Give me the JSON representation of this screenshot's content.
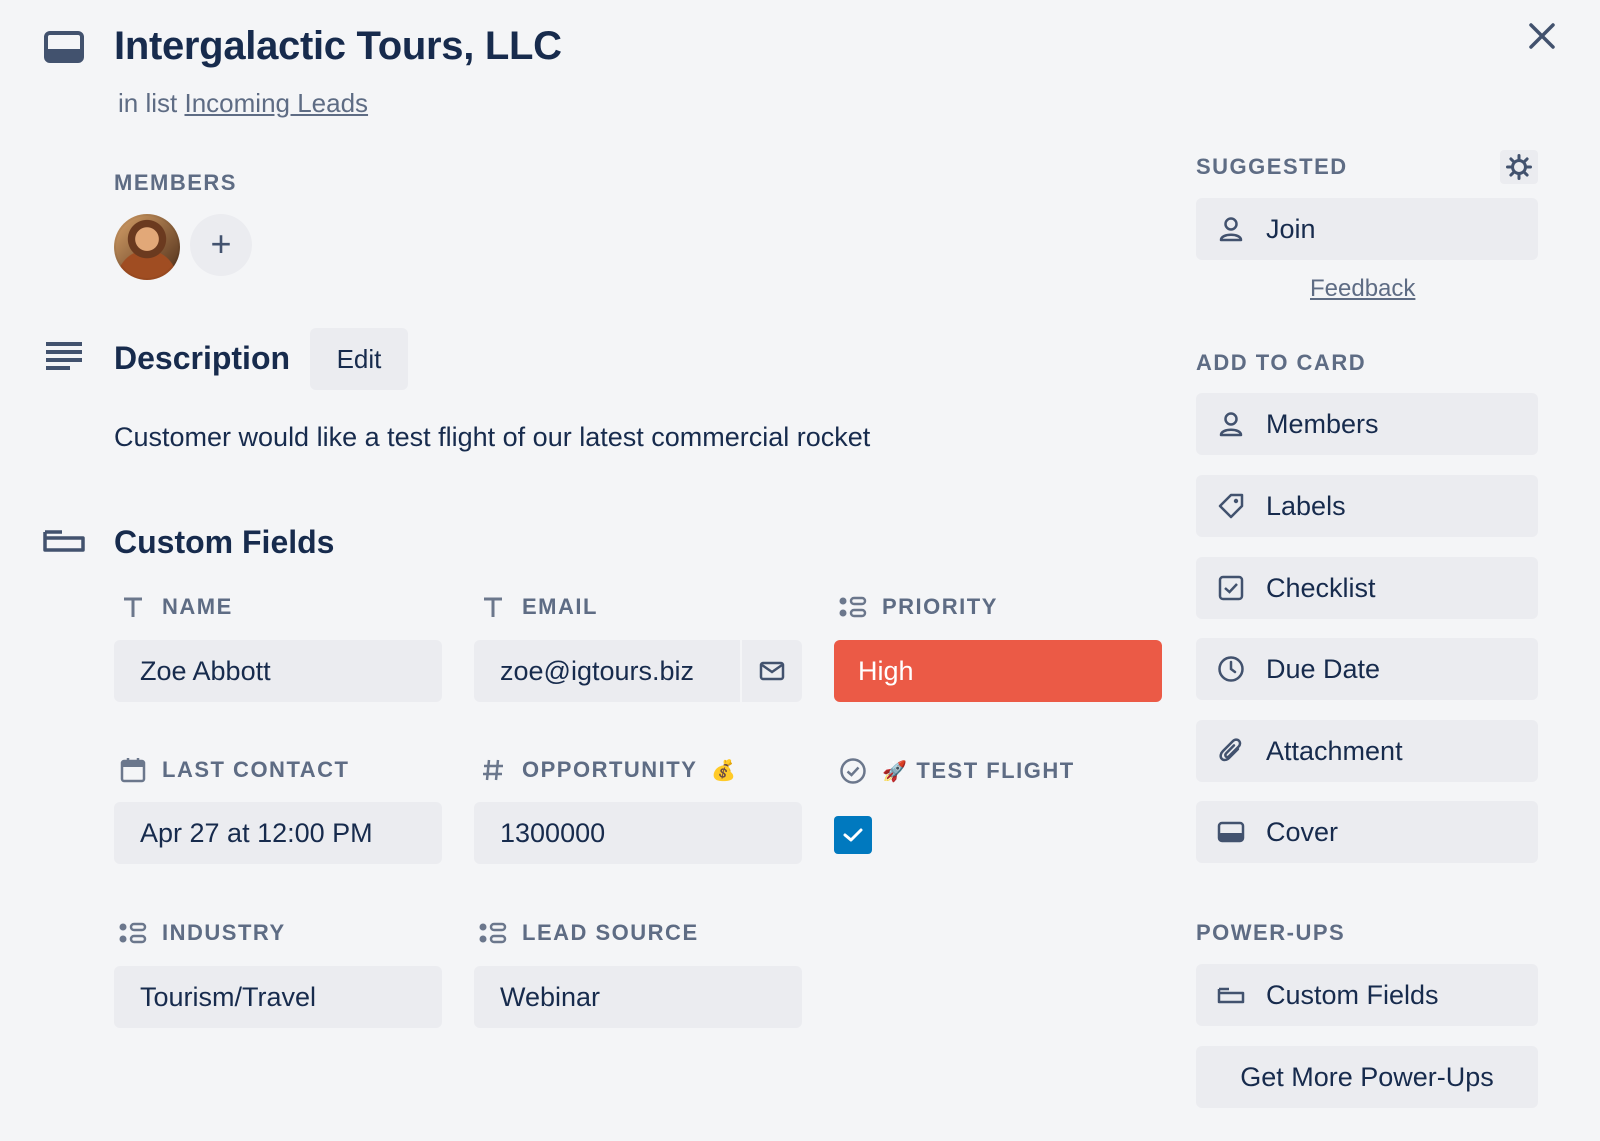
{
  "card": {
    "title": "Intergalactic Tours, LLC",
    "list_prefix": "in list",
    "list_name": "Incoming Leads"
  },
  "members": {
    "label": "MEMBERS",
    "add_symbol": "+"
  },
  "description": {
    "title": "Description",
    "edit_label": "Edit",
    "text": "Customer would like a test flight of our latest commercial rocket"
  },
  "custom_fields": {
    "title": "Custom Fields",
    "name": {
      "label": "NAME",
      "value": "Zoe Abbott",
      "icon": "text-icon"
    },
    "email": {
      "label": "EMAIL",
      "value": "zoe@igtours.biz",
      "icon": "text-icon"
    },
    "priority": {
      "label": "PRIORITY",
      "value": "High",
      "icon": "dropdown-icon",
      "color": "#eb5a46"
    },
    "last_contact": {
      "label": "LAST CONTACT",
      "value": "Apr 27 at 12:00 PM",
      "icon": "calendar-icon"
    },
    "opportunity": {
      "label": "OPPORTUNITY",
      "emoji": "💰",
      "value": "1300000",
      "icon": "hash-icon"
    },
    "test_flight": {
      "label": "TEST FLIGHT",
      "emoji": "🚀",
      "checked": true,
      "icon": "check-circle-icon",
      "color": "#0079bf"
    },
    "industry": {
      "label": "INDUSTRY",
      "value": "Tourism/Travel",
      "icon": "dropdown-icon"
    },
    "lead_source": {
      "label": "LEAD SOURCE",
      "value": "Webinar",
      "icon": "dropdown-icon"
    }
  },
  "sidebar": {
    "suggested_label": "SUGGESTED",
    "join_label": "Join",
    "feedback_label": "Feedback",
    "add_to_card_label": "ADD TO CARD",
    "add_items": [
      "Members",
      "Labels",
      "Checklist",
      "Due Date",
      "Attachment",
      "Cover"
    ],
    "powerups_label": "POWER-UPS",
    "custom_fields_label": "Custom Fields",
    "more_powerups_label": "Get More Power-Ups"
  }
}
